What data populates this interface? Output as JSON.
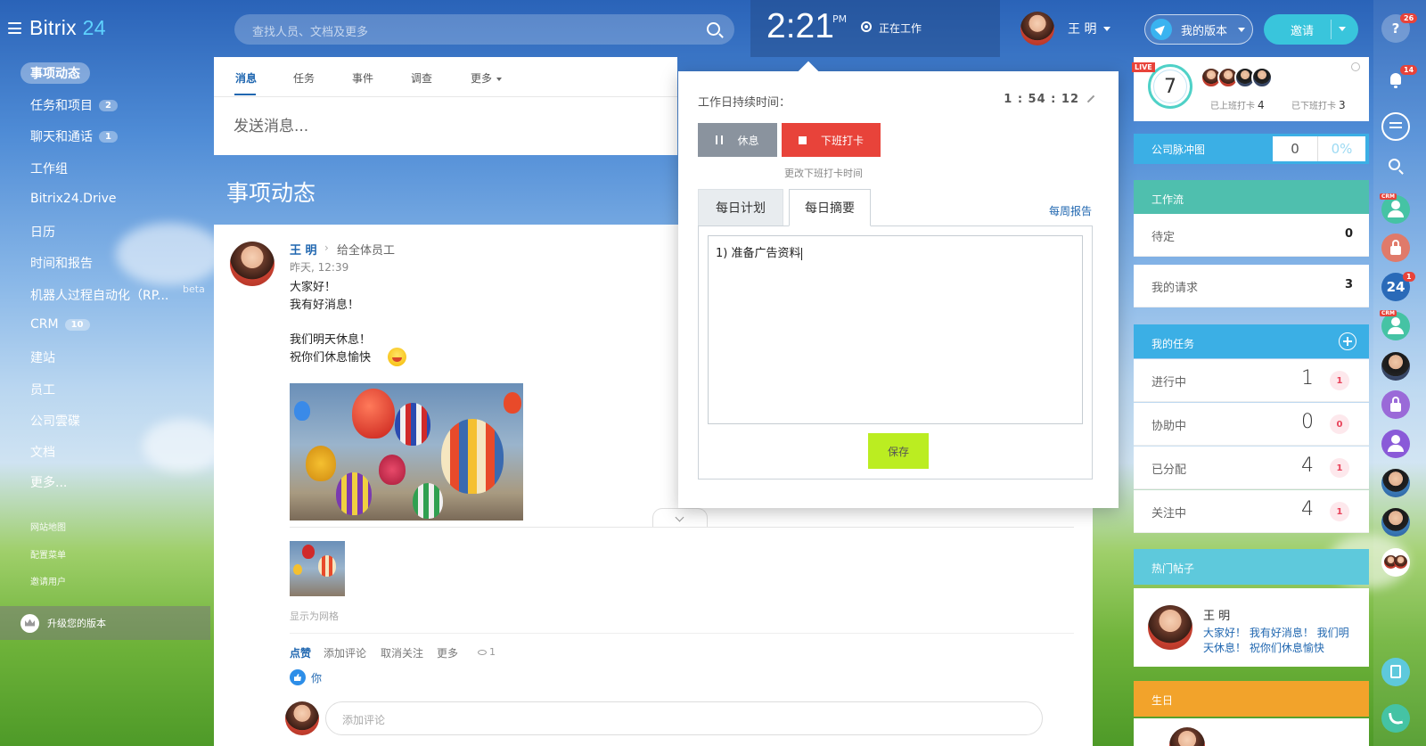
{
  "app": {
    "logo_main": "Bitrix",
    "logo_num": "24"
  },
  "header": {
    "search_placeholder": "查找人员、文档及更多",
    "time": "2:21",
    "ampm": "PM",
    "work_status": "正在工作",
    "user_name": "王 明",
    "my_version": "我的版本",
    "invite": "邀请"
  },
  "sidebar": {
    "items": [
      {
        "label": "事项动态",
        "badge": ""
      },
      {
        "label": "任务和项目",
        "badge": "2"
      },
      {
        "label": "聊天和通话",
        "badge": "1"
      },
      {
        "label": "工作组",
        "badge": ""
      },
      {
        "label": "Bitrix24.Drive",
        "badge": ""
      },
      {
        "label": "日历",
        "badge": ""
      },
      {
        "label": "时间和报告",
        "badge": ""
      },
      {
        "label": "机器人过程自动化（RP...",
        "badge": ""
      },
      {
        "label": "CRM",
        "badge": "10"
      },
      {
        "label": "建站",
        "badge": ""
      },
      {
        "label": "员工",
        "badge": ""
      },
      {
        "label": "公司雲碟",
        "badge": ""
      },
      {
        "label": "文档",
        "badge": ""
      },
      {
        "label": "更多...",
        "badge": ""
      }
    ],
    "beta": "beta",
    "small": [
      "网站地图",
      "配置菜单",
      "邀请用户"
    ],
    "upgrade": "升级您的版本"
  },
  "feed": {
    "tabs": [
      "消息",
      "任务",
      "事件",
      "调查",
      "更多"
    ],
    "send_placeholder": "发送消息...",
    "title": "事项动态",
    "post": {
      "author": "王 明",
      "to": "给全体员工",
      "date": "昨天, 12:39",
      "lines": [
        "大家好！",
        "我有好消息！",
        "",
        "我们明天休息！",
        "祝你们休息愉快"
      ],
      "grid_label": "显示为网格",
      "actions": [
        "点赞",
        "添加评论",
        "取消关注",
        "更多"
      ],
      "views": "1",
      "liked_by": "你",
      "comment_placeholder": "添加评论"
    }
  },
  "workday": {
    "duration_label": "工作日持续时间：",
    "duration": "1 : 54 : 12",
    "break_label": "休息",
    "stop_label": "下班打卡",
    "change_time": "更改下班打卡时间",
    "tab_plan": "每日计划",
    "tab_summary": "每日摘要",
    "weekly_report": "每周报告",
    "summary_text": "1) 准备广告资料",
    "save": "保存"
  },
  "right": {
    "live": "LIVE",
    "count": "7",
    "clocked_in_label": "已上班打卡",
    "clocked_in": "4",
    "clocked_out_label": "已下班打卡",
    "clocked_out": "3",
    "pulse_label": "公司脉冲图",
    "pulse_value": "0",
    "pulse_pct": "0%",
    "workflow": {
      "title": "工作流",
      "rows": [
        {
          "label": "待定",
          "value": "0"
        },
        {
          "label": "我的请求",
          "value": "3"
        }
      ]
    },
    "tasks": {
      "title": "我的任务",
      "rows": [
        {
          "label": "进行中",
          "value": "1",
          "count": "1"
        },
        {
          "label": "协助中",
          "value": "0",
          "count": "0"
        },
        {
          "label": "已分配",
          "value": "4",
          "count": "1"
        },
        {
          "label": "关注中",
          "value": "4",
          "count": "1"
        }
      ]
    },
    "hot": {
      "title": "热门帖子",
      "author": "王 明",
      "text": "大家好！ 我有好消息！ 我们明天休息！ 祝你们休息愉快"
    },
    "birthday": {
      "title": "生日"
    }
  },
  "strip": {
    "help_badge": "26",
    "bell_badge": "14",
    "b24_badge": "1",
    "crm_tag": "CRM"
  },
  "colors": {
    "accent": "#2067b0",
    "stop": "#e8433a",
    "save": "#bbed21",
    "pulse": "#3bafe5",
    "workflow": "#4fbfae",
    "tasks": "#3bafe5",
    "hot": "#5ec9dc",
    "birthday": "#f2a32b"
  }
}
